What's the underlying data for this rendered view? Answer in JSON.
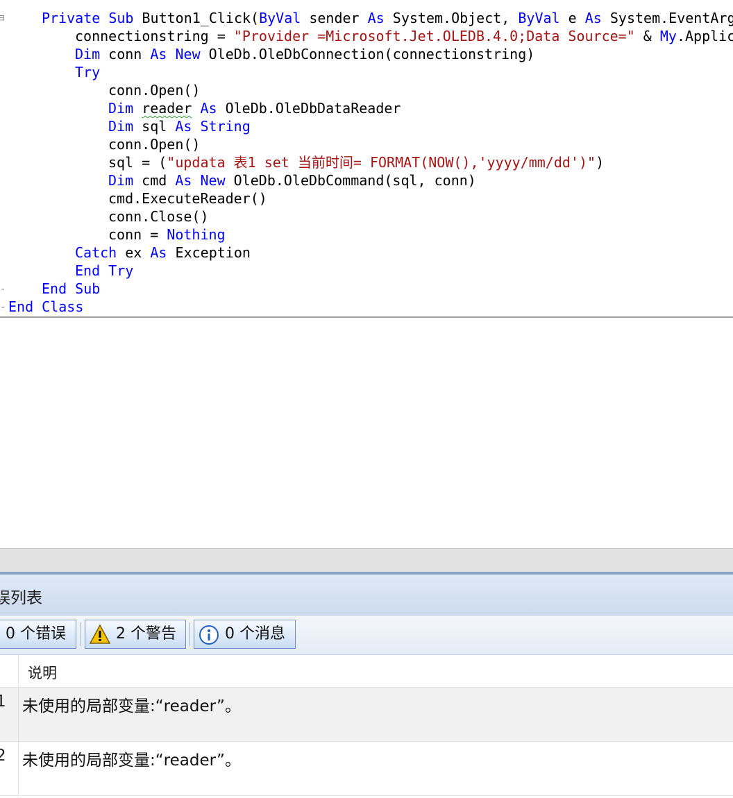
{
  "editor": {
    "lines": [
      [
        {
          "t": "Private",
          "k": 1
        },
        {
          "t": " "
        },
        {
          "t": "Sub",
          "k": 1
        },
        {
          "t": " Button1_Click("
        },
        {
          "t": "ByVal",
          "k": 1
        },
        {
          "t": " sender "
        },
        {
          "t": "As",
          "k": 1
        },
        {
          "t": " System.Object, "
        },
        {
          "t": "ByVal",
          "k": 1
        },
        {
          "t": " e "
        },
        {
          "t": "As",
          "k": 1
        },
        {
          "t": " System.EventArg"
        }
      ],
      [
        {
          "t": "connectionstring = "
        },
        {
          "t": "\"Provider =Microsoft.Jet.OLEDB.4.0;Data Source=\"",
          "s": 1
        },
        {
          "t": " & "
        },
        {
          "t": "My",
          "k": 1
        },
        {
          "t": ".Applic"
        }
      ],
      [
        {
          "t": "Dim",
          "k": 1
        },
        {
          "t": " conn "
        },
        {
          "t": "As",
          "k": 1
        },
        {
          "t": " "
        },
        {
          "t": "New",
          "k": 1
        },
        {
          "t": " OleDb.OleDbConnection(connectionstring)"
        }
      ],
      [
        {
          "t": "Try",
          "k": 1
        }
      ],
      [
        {
          "t": "conn.Open()"
        }
      ],
      [
        {
          "t": "Dim",
          "k": 1
        },
        {
          "t": " "
        },
        {
          "t": "reader",
          "w": 1
        },
        {
          "t": " "
        },
        {
          "t": "As",
          "k": 1
        },
        {
          "t": " OleDb.OleDbDataReader"
        }
      ],
      [
        {
          "t": "Dim",
          "k": 1
        },
        {
          "t": " sql "
        },
        {
          "t": "As",
          "k": 1
        },
        {
          "t": " "
        },
        {
          "t": "String",
          "k": 1
        }
      ],
      [
        {
          "t": "conn.Open()"
        }
      ],
      [
        {
          "t": "sql = ("
        },
        {
          "t": "\"updata 表1 set 当前时间= FORMAT(NOW(),'yyyy/mm/dd')\"",
          "s": 1
        },
        {
          "t": ")"
        }
      ],
      [
        {
          "t": "Dim",
          "k": 1
        },
        {
          "t": " cmd "
        },
        {
          "t": "As",
          "k": 1
        },
        {
          "t": " "
        },
        {
          "t": "New",
          "k": 1
        },
        {
          "t": " OleDb.OleDbCommand(sql, conn)"
        }
      ],
      [
        {
          "t": "cmd.ExecuteReader()"
        }
      ],
      [
        {
          "t": "conn.Close()"
        }
      ],
      [
        {
          "t": "conn = "
        },
        {
          "t": "Nothing",
          "k": 1
        }
      ],
      [
        {
          "t": "Catch",
          "k": 1
        },
        {
          "t": " ex "
        },
        {
          "t": "As",
          "k": 1
        },
        {
          "t": " Exception"
        }
      ],
      [
        {
          "t": "End",
          "k": 1
        },
        {
          "t": " "
        },
        {
          "t": "Try",
          "k": 1
        }
      ],
      [
        {
          "t": "End",
          "k": 1
        },
        {
          "t": " "
        },
        {
          "t": "Sub",
          "k": 1
        }
      ],
      [
        {
          "t": "End",
          "k": 1
        },
        {
          "t": " "
        },
        {
          "t": "Class",
          "k": 1
        }
      ]
    ]
  },
  "error_list": {
    "title": "误列表",
    "filters": {
      "errors": "0 个错误",
      "warnings": "2 个警告",
      "messages": "0 个消息"
    },
    "columns": {
      "description": "说明"
    },
    "rows": [
      {
        "num": "1",
        "description": "未使用的局部变量:“reader”。"
      },
      {
        "num": "2",
        "description": "未使用的局部变量:“reader”。"
      }
    ]
  },
  "colors": {
    "keyword": "#0000ff",
    "string": "#a31515",
    "squiggle": "#2ca02c",
    "warning": "#f5c400"
  }
}
